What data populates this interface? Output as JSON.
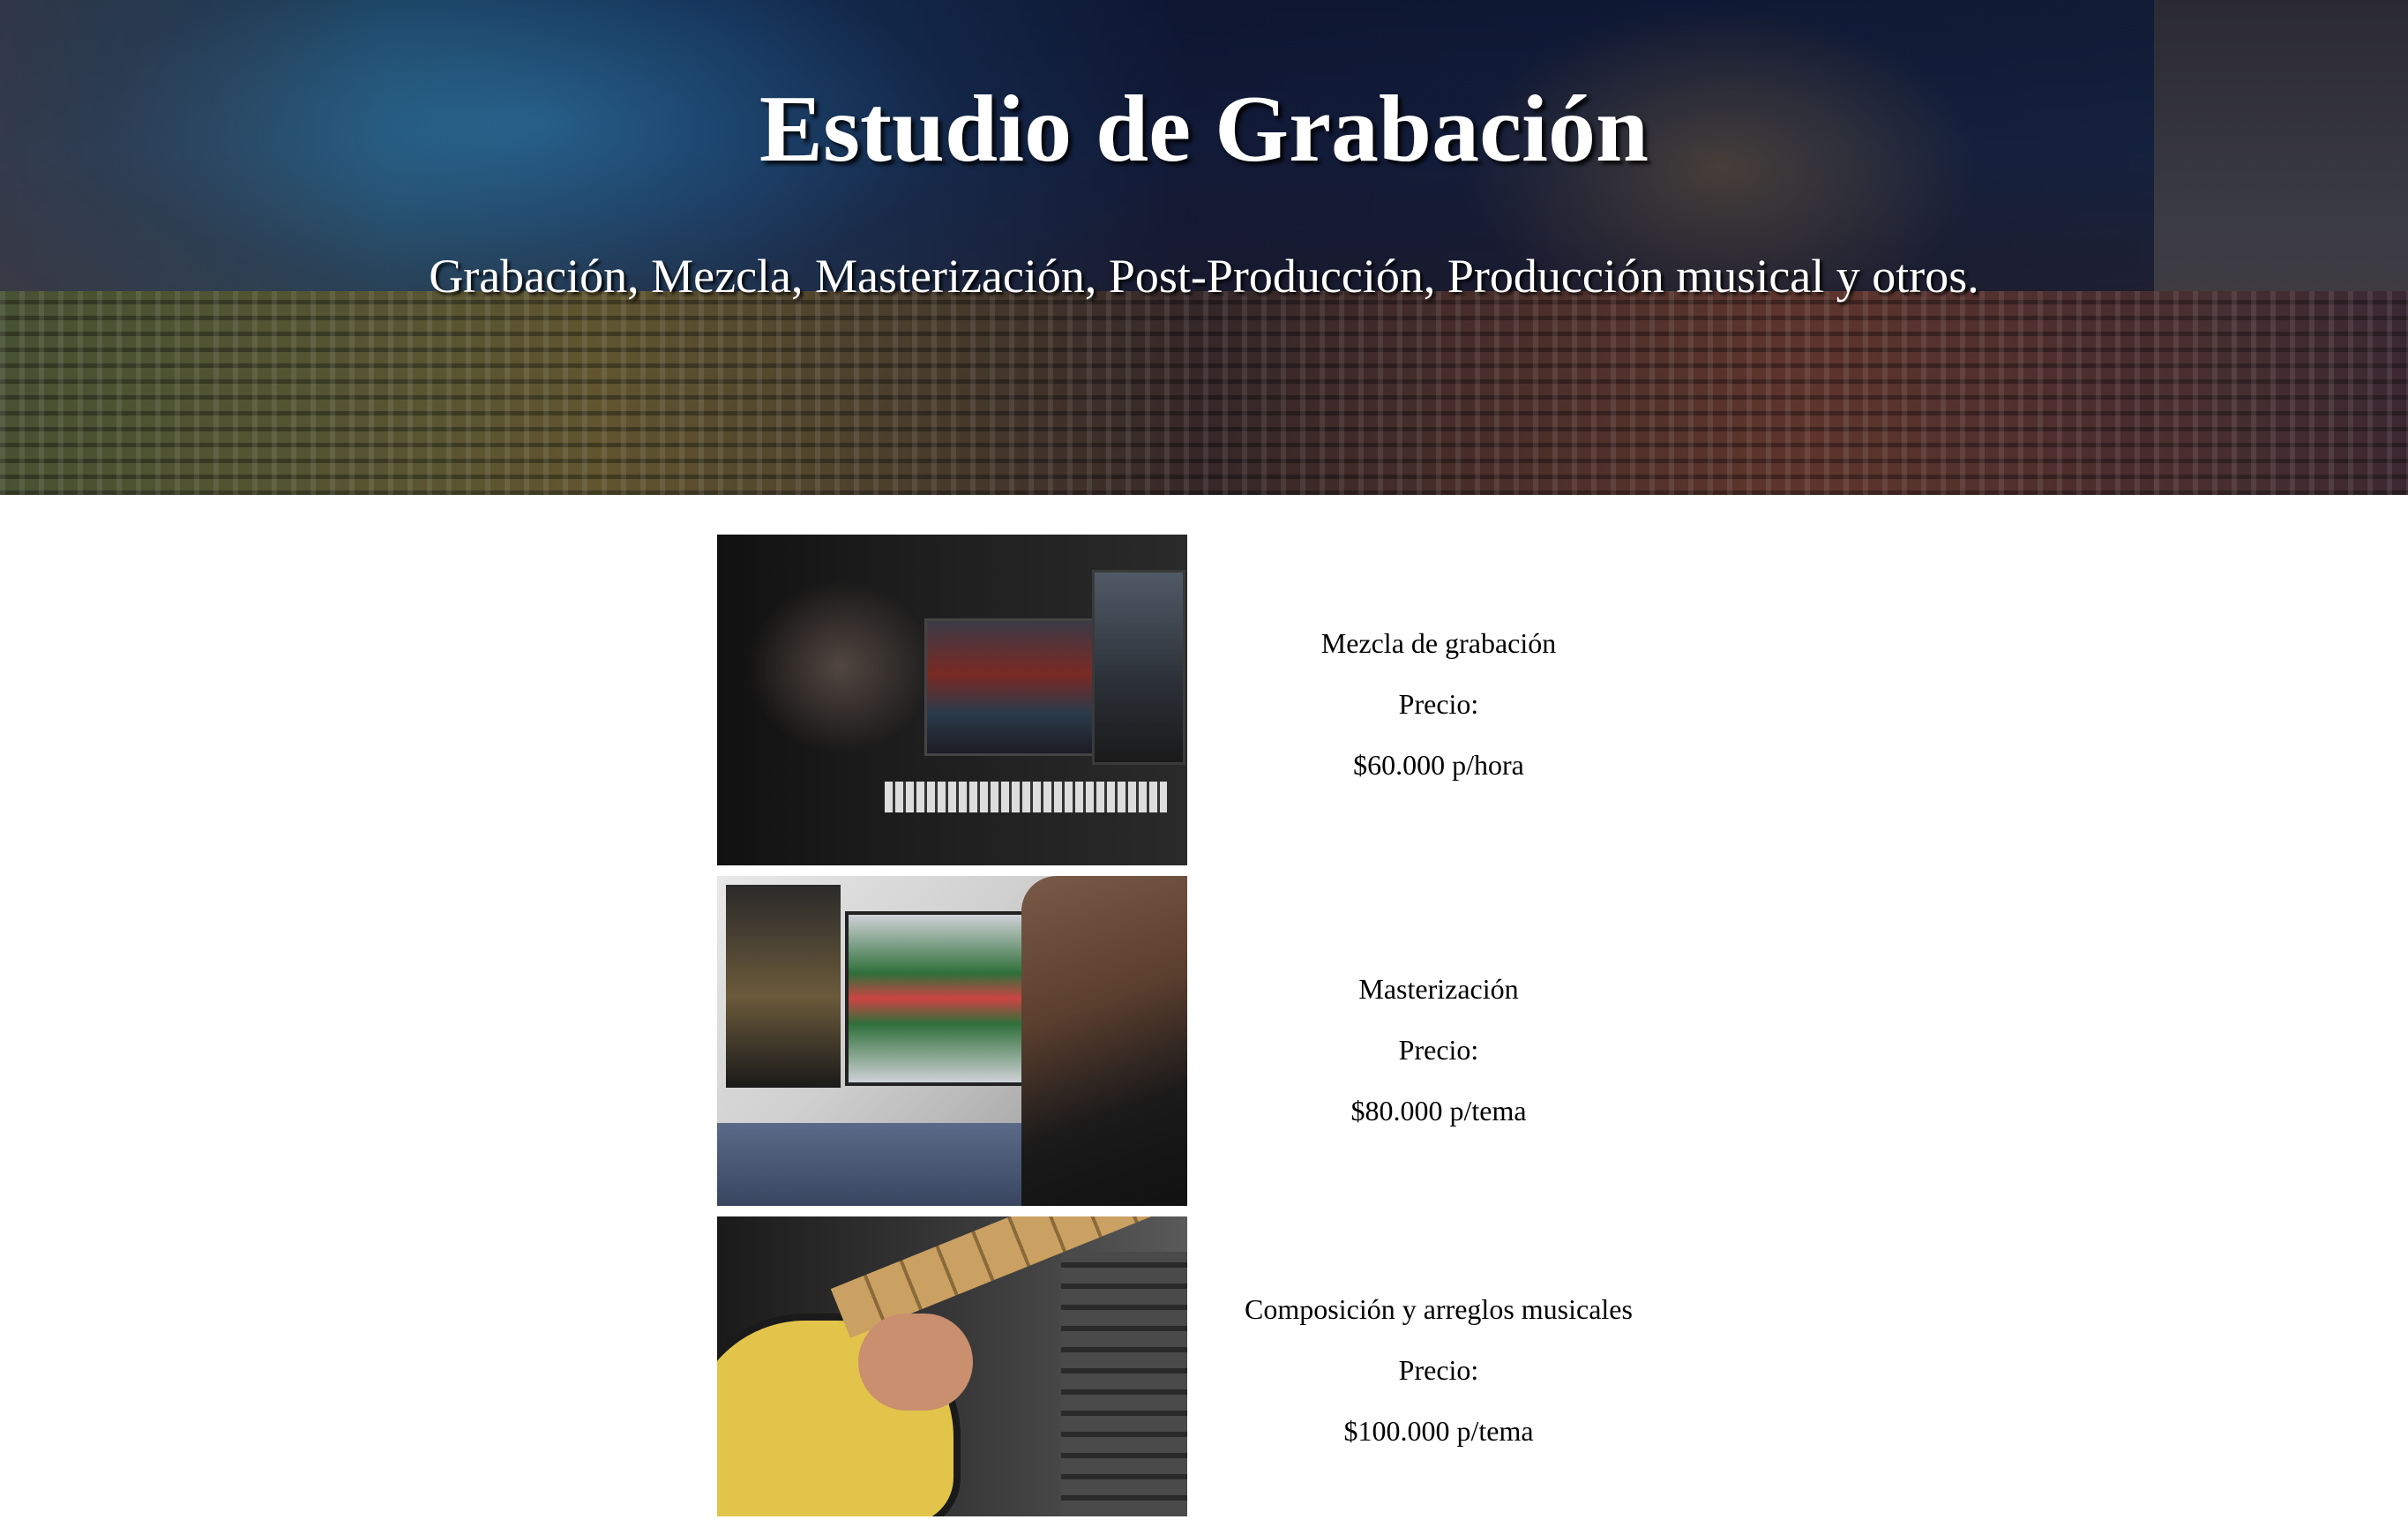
{
  "hero": {
    "title": "Estudio de Grabación",
    "subtitle": "Grabación, Mezcla, Masterización, Post-Producción, Producción musical y otros."
  },
  "services": [
    {
      "image": "mixing-studio-photo",
      "name": "Mezcla de grabación",
      "price_label": "Precio:",
      "price": "$60.000 p/hora"
    },
    {
      "image": "mastering-headphones-photo",
      "name": "Masterización",
      "price_label": "Precio:",
      "price": "$80.000 p/tema"
    },
    {
      "image": "guitar-player-photo",
      "name": "Composición y arreglos musicales",
      "price_label": "Precio:",
      "price": "$100.000 p/tema"
    }
  ]
}
